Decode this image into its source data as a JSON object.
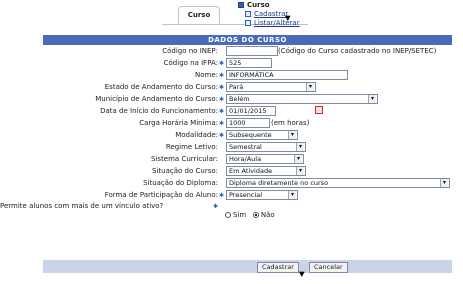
{
  "nav": {
    "tab_label": "Curso",
    "menu_title": "Curso",
    "menu_items": [
      "Cadastrar",
      "Listar/Alterar"
    ]
  },
  "form": {
    "caption": "DADOS DO CURSO",
    "inep": {
      "label": "Código no INEP:",
      "value": "",
      "note": "(Código do Curso cadastrado no INEP/SETEC)"
    },
    "ifpa": {
      "label": "Código na IFPA:",
      "value": "525"
    },
    "nome": {
      "label": "Nome:",
      "value": "INFORMÁTICA"
    },
    "estado": {
      "label": "Estado de Andamento do Curso:",
      "value": "Pará"
    },
    "municipio": {
      "label": "Município de Andamento do Curso:",
      "value": "Belém"
    },
    "data_inicio": {
      "label": "Data de Início do Funcionamento:",
      "value": "01/01/2015"
    },
    "carga": {
      "label": "Carga Horária Mínima:",
      "value": "1000",
      "note": "(em horas)"
    },
    "modalidade": {
      "label": "Modalidade:",
      "value": "Subsequente"
    },
    "regime": {
      "label": "Regime Letivo:",
      "value": "Semestral"
    },
    "sistema": {
      "label": "Sistema Curricular:",
      "value": "Hora/Aula"
    },
    "situacao": {
      "label": "Situação do Curso:",
      "value": "Em Atividade"
    },
    "situacao_diploma": {
      "label": "Situação do Diploma:",
      "value": "Diploma diretamente no curso"
    },
    "forma": {
      "label": "Forma de Participação do Aluno:",
      "value": "Presencial"
    },
    "vinculo": {
      "label": "Permite alunos com mais de um vínculo ativo?",
      "options": [
        "Sim",
        "Não"
      ],
      "selected": "Não"
    }
  },
  "buttons": {
    "submit": "Cadastrar",
    "cancel": "Cancelar"
  },
  "colors": {
    "caption_bg": "#4a6bb8",
    "footer_bg": "#c9d4ea",
    "required_star": "#2f5db8"
  }
}
